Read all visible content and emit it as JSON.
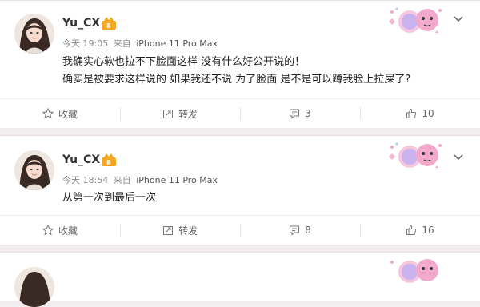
{
  "posts": [
    {
      "username": "Yu_CX",
      "time": "今天 19:05",
      "source_prefix": "来自",
      "device": "iPhone 11 Pro Max",
      "lines": [
        "我确实心软也拉不下脸面这样 没有什么好公开说的！",
        "确实是被要求这样说的 如果我还不说 为了脸面 是不是可以蹲我脸上拉屎了?"
      ],
      "actions": {
        "favorite": "收藏",
        "repost": "转发",
        "comments": "3",
        "likes": "10"
      }
    },
    {
      "username": "Yu_CX",
      "time": "今天 18:54",
      "source_prefix": "来自",
      "device": "iPhone 11 Pro Max",
      "lines": [
        "从第一次到最后一次"
      ],
      "actions": {
        "favorite": "收藏",
        "repost": "转发",
        "comments": "8",
        "likes": "16"
      }
    }
  ],
  "colors": {
    "page_bg": "#f2eef0",
    "vip_badge": "#f5a623",
    "text_primary": "#222222",
    "text_meta": "#888888"
  },
  "icons": {
    "favorite": "star-icon",
    "repost": "repost-icon",
    "comment": "comment-icon",
    "like": "thumbs-up-icon",
    "more": "chevron-down-icon",
    "badge": "vip-crown-icon"
  }
}
